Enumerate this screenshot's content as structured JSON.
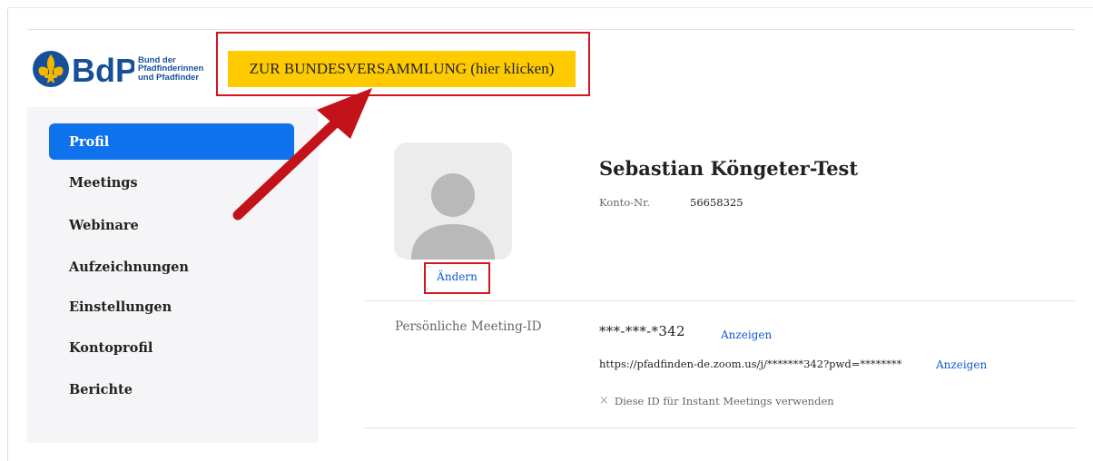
{
  "logo": {
    "brand": "BdP",
    "line1": "Bund der",
    "line2": "Pfadfinderinnen",
    "line3": "und Pfadfinder",
    "colors": {
      "blue": "#17509a",
      "gold": "#f5b600"
    }
  },
  "banner": {
    "label": "ZUR BUNDESVERSAMMLUNG (hier klicken)",
    "color": "#fecb00"
  },
  "sidebar": {
    "items": [
      {
        "label": "Profil",
        "active": true
      },
      {
        "label": "Meetings"
      },
      {
        "label": "Webinare"
      },
      {
        "label": "Aufzeichnungen"
      },
      {
        "label": "Einstellungen"
      },
      {
        "label": "Kontoprofil"
      },
      {
        "label": "Berichte"
      }
    ]
  },
  "profile": {
    "change_label": "Ändern",
    "name": "Sebastian Köngeter-Test",
    "account_label": "Konto-Nr.",
    "account_value": "56658325"
  },
  "meeting": {
    "label": "Persönliche Meeting-ID",
    "id_masked": "***-***-*342",
    "show_label": "Anzeigen",
    "url_masked": "https://pfadfinden-de.zoom.us/j/*******342?pwd=********",
    "url_show_label": "Anzeigen",
    "instant_label": "Diese ID für Instant Meetings verwenden"
  },
  "accent_colors": {
    "annotation_red": "#d2161c",
    "active_blue": "#0e72ed",
    "link_blue": "#0e5ad6"
  }
}
